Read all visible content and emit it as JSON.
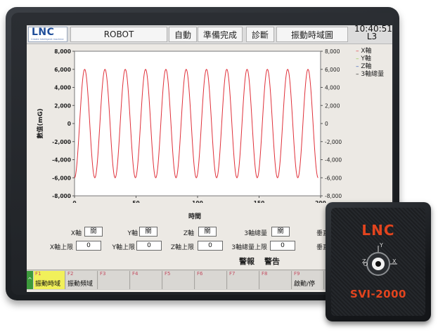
{
  "header": {
    "logo_text": "LNC",
    "logo_tagline": "Create Intelligent machine",
    "mode_label": "ROBOT",
    "auto_label": "自動",
    "status_label": "準備完成",
    "diag_label": "診斷",
    "page_label": "振動時域圖",
    "time": "10:40:51",
    "level": "L3"
  },
  "legend": [
    {
      "label": "X軸",
      "color": "#e0303a"
    },
    {
      "label": "Y軸",
      "color": "#8cc63f"
    },
    {
      "label": "Z軸",
      "color": "#2b58b7"
    },
    {
      "label": "3軸總量",
      "color": "#222222"
    }
  ],
  "chart_data": {
    "type": "line",
    "ylabel": "數值(mG)",
    "xlabel": "時間",
    "xlim": [
      0,
      200
    ],
    "ylim": [
      -8000,
      8000
    ],
    "x_ticks": [
      "0",
      "50",
      "100",
      "150",
      "200"
    ],
    "y_ticks_left": [
      "8,000",
      "6,000",
      "4,000",
      "2,000",
      "0",
      "-2,000",
      "-4,000",
      "-6,000",
      "-8,000"
    ],
    "y_ticks_right": [
      "8,000",
      "6,000",
      "4,000",
      "2,000",
      "0",
      "-2,000",
      "-4,000",
      "-6,000",
      "-8,000"
    ],
    "grid": false,
    "series": [
      {
        "name": "X軸",
        "color": "#e0303a",
        "amplitude": 6000,
        "cycles": 12,
        "phase_deg": -90,
        "x_range": [
          0,
          198
        ]
      }
    ]
  },
  "params": {
    "row1": [
      {
        "label": "X軸",
        "value": "開"
      },
      {
        "label": "Y軸",
        "value": "關"
      },
      {
        "label": "Z軸",
        "value": "關"
      },
      {
        "label": "3軸總量",
        "value": "關"
      },
      {
        "label": "垂直"
      }
    ],
    "row2": [
      {
        "label": "X軸上限",
        "value": "0"
      },
      {
        "label": "Y軸上限",
        "value": "0"
      },
      {
        "label": "Z軸上限",
        "value": "0"
      },
      {
        "label": "3軸總量上限",
        "value": "0"
      },
      {
        "label": "垂直"
      }
    ]
  },
  "alarm": {
    "alarm_label": "警報",
    "warning_label": "警告"
  },
  "fkeys": [
    {
      "num": "F1",
      "label": "振動時域"
    },
    {
      "num": "F2",
      "label": "振動頻域"
    },
    {
      "num": "F3",
      "label": ""
    },
    {
      "num": "F4",
      "label": ""
    },
    {
      "num": "F5",
      "label": ""
    },
    {
      "num": "F6",
      "label": ""
    },
    {
      "num": "F7",
      "label": ""
    },
    {
      "num": "F8",
      "label": ""
    },
    {
      "num": "F9",
      "label": "啟動/停"
    }
  ],
  "fkey_up": "^",
  "device": {
    "logo": "LNC",
    "model": "SVI-2000",
    "axis_x": "X",
    "axis_y": "Y",
    "axis_z": "Z"
  }
}
